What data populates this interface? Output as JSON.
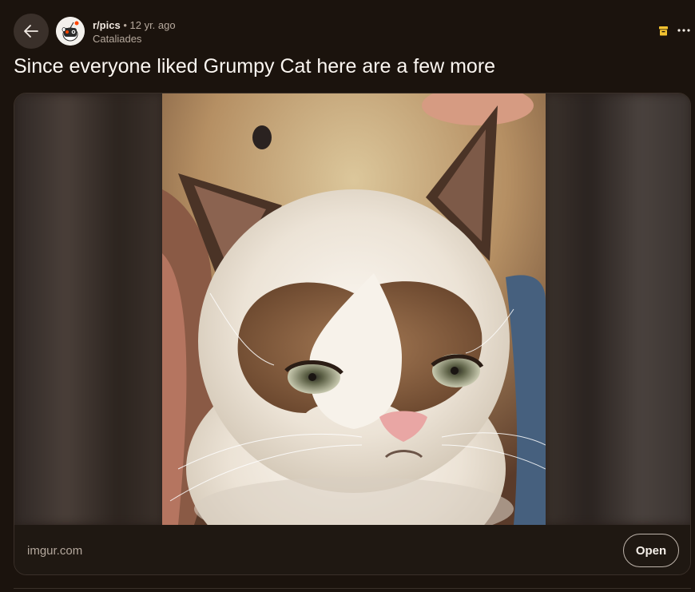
{
  "header": {
    "subreddit": "r/pics",
    "separator": "•",
    "age": "12 yr. ago",
    "author": "Cataliades"
  },
  "post": {
    "title": "Since everyone liked Grumpy Cat here are a few more"
  },
  "media": {
    "domain": "imgur.com",
    "open_label": "Open"
  },
  "icons": {
    "back": "arrow-left-icon",
    "archive": "archive-icon",
    "more": "more-horizontal-icon"
  },
  "colors": {
    "background": "#1b130d",
    "archive_accent": "#f2c230",
    "text_primary": "#fbf6f1",
    "text_secondary": "#b6a99d"
  }
}
